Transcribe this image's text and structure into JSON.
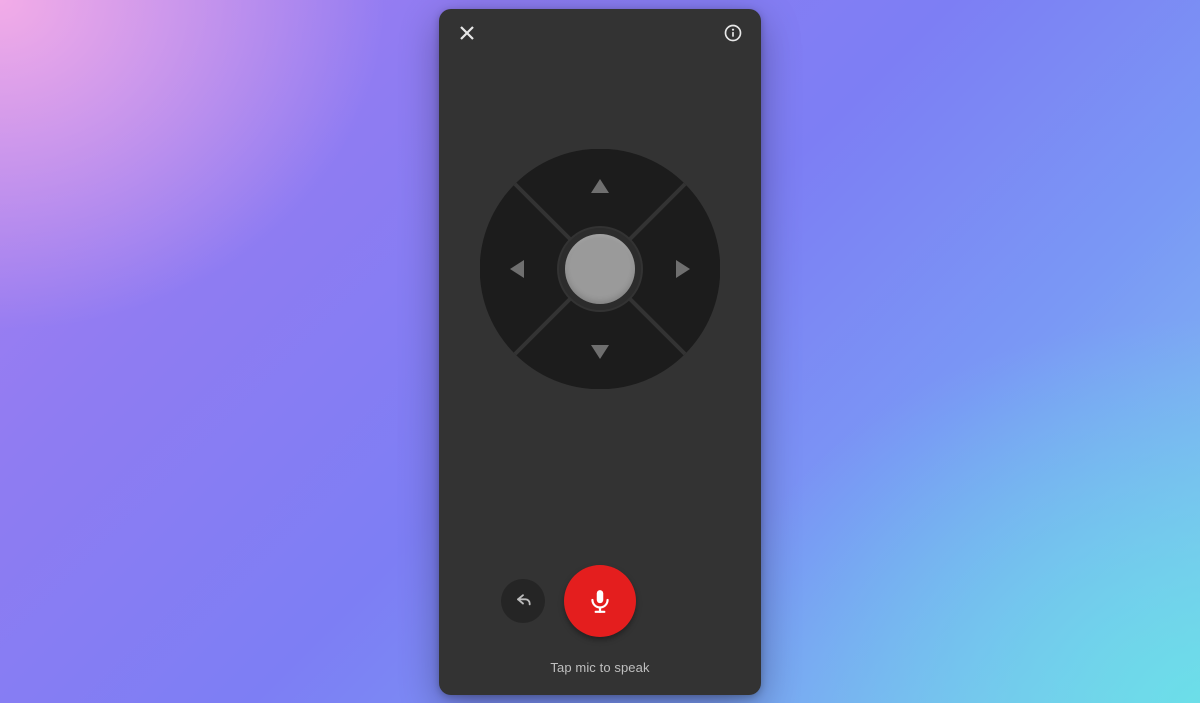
{
  "colors": {
    "panel_bg": "#333333",
    "dpad_bg": "#1c1c1c",
    "dpad_arrow": "#6f6f6f",
    "dpad_center": "#9a9a9a",
    "mic_bg": "#e41e1e",
    "text_muted": "#bfbfbf"
  },
  "topbar": {
    "close_icon": "close-icon",
    "info_icon": "info-icon"
  },
  "dpad": {
    "up": "dpad-up",
    "down": "dpad-down",
    "left": "dpad-left",
    "right": "dpad-right",
    "center": "dpad-select"
  },
  "controls": {
    "back_icon": "undo-icon",
    "mic_icon": "microphone-icon"
  },
  "hint": "Tap mic to speak"
}
